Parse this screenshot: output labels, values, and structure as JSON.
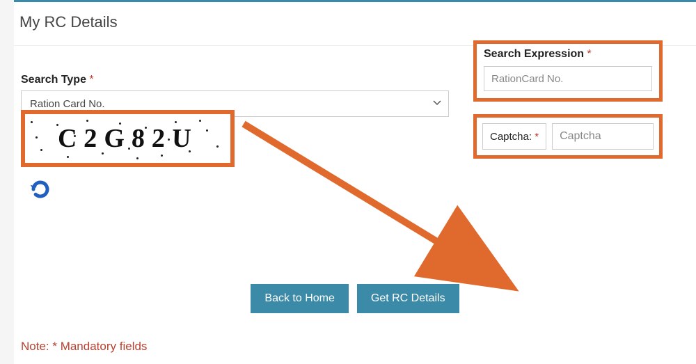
{
  "title": "My RC Details",
  "search_type": {
    "label": "Search Type",
    "required": "*",
    "value": "Ration Card No."
  },
  "search_expression": {
    "label": "Search Expression",
    "required": "*",
    "placeholder": "RationCard No."
  },
  "captcha": {
    "image_text": "C2G82U",
    "label": "Captcha:",
    "required": "*",
    "placeholder": "Captcha"
  },
  "buttons": {
    "back": "Back to Home",
    "get": "Get RC Details"
  },
  "note": "Note: * Mandatory fields",
  "icons": {
    "refresh": "refresh-icon",
    "chevron": "chevron-down-icon"
  }
}
